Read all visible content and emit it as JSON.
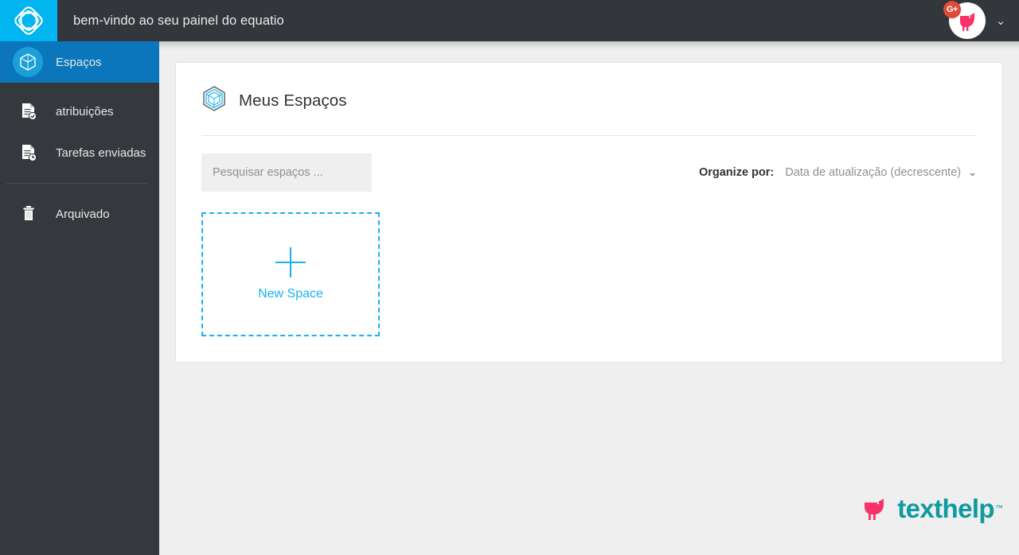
{
  "topbar": {
    "logo_icon": "equatio-diamond-logo-icon",
    "title": "bem-vindo ao seu painel do equatio",
    "badge_label": "G+",
    "badge_icon": "google-plus-badge-icon",
    "avatar_icon": "texthelp-bird-avatar",
    "caret_icon": "chevron-down-icon",
    "caret_glyph": "⌄",
    "bg_color": "#33363a",
    "logo_bg_color": "#00b5f0",
    "badge_color": "#dd4b39"
  },
  "sidebar": {
    "bg_color": "#35383c",
    "active_color": "#0b76bc",
    "active_circle_color": "#1a9fd9",
    "items": [
      {
        "id": "espacos",
        "label": "Espaços",
        "icon": "cube-icon",
        "active": true
      },
      {
        "id": "atribuicoes",
        "label": "atribuições",
        "icon": "document-check-icon",
        "active": false
      },
      {
        "id": "tarefas",
        "label": "Tarefas enviadas",
        "icon": "document-clock-icon",
        "active": false
      },
      {
        "id": "arquivado",
        "label": "Arquivado",
        "icon": "trash-icon",
        "active": false
      }
    ]
  },
  "main": {
    "card": {
      "title": "Meus Espaços",
      "title_icon": "cube-outline-icon"
    },
    "search": {
      "placeholder": "Pesquisar espaços ...",
      "value": ""
    },
    "sort": {
      "label": "Organize por:",
      "value": "Data de atualização (decrescente)",
      "caret_icon": "chevron-down-icon",
      "caret_glyph": "⌄"
    },
    "new_space": {
      "label": "New Space",
      "plus_icon": "plus-icon",
      "accent_color": "#18b0f0"
    }
  },
  "footer": {
    "brand": "texthelp",
    "trademark": "™",
    "bird_icon": "texthelp-bird-icon",
    "bird_color": "#f9316b",
    "word_color": "#0e9aa0"
  }
}
